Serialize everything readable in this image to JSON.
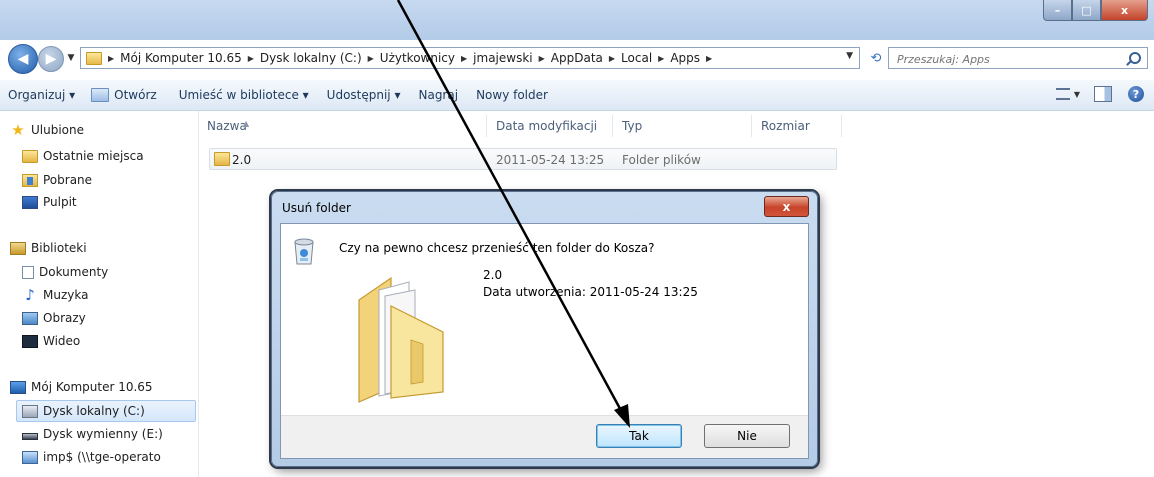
{
  "window": {
    "caption_min": "–",
    "caption_max": "□",
    "caption_close": "x"
  },
  "address_bar": {
    "crumbs": [
      "Mój Komputer 10.65",
      "Dysk lokalny (C:)",
      "Użytkownicy",
      "jmajewski",
      "AppData",
      "Local",
      "Apps"
    ]
  },
  "search": {
    "placeholder": "Przeszukaj: Apps"
  },
  "toolbar": {
    "organize": "Organizuj ▾",
    "open": "Otwórz",
    "include_in_library": "Umieść w bibliotece ▾",
    "share": "Udostępnij ▾",
    "burn": "Nagraj",
    "new_folder": "Nowy folder",
    "help": "?"
  },
  "nav_pane": {
    "favorites": {
      "header": "Ulubione",
      "items": [
        "Ostatnie miejsca",
        "Pobrane",
        "Pulpit"
      ]
    },
    "libraries": {
      "header": "Biblioteki",
      "items": [
        "Dokumenty",
        "Muzyka",
        "Obrazy",
        "Wideo"
      ]
    },
    "computer": {
      "header": "Mój Komputer 10.65",
      "items": [
        "Dysk lokalny (C:)",
        "Dysk wymienny (E:)",
        "imp$ (\\\\tge-operato"
      ]
    }
  },
  "columns": {
    "name": "Nazwa",
    "modified": "Data modyfikacji",
    "type": "Typ",
    "size": "Rozmiar"
  },
  "files": [
    {
      "name": "2.0",
      "modified": "2011-05-24 13:25",
      "type": "Folder plików",
      "size": ""
    }
  ],
  "dialog": {
    "title": "Usuń folder",
    "close": "x",
    "question": "Czy na pewno chcesz przenieść ten folder do Kosza?",
    "item_name": "2.0",
    "item_created": "Data utworzenia: 2011-05-24 13:25",
    "yes_label": "Tak",
    "no_label": "Nie"
  },
  "colors": {
    "accent": "#1f5ba8",
    "arrow": "#000000",
    "close_red": "#c8432a"
  }
}
